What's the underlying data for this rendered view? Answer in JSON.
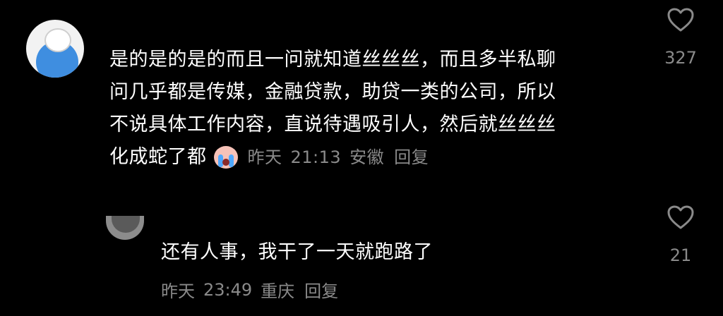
{
  "comment1": {
    "lines": [
      "是的是的是的而且一问就知道丝丝丝，而且多半私聊",
      "问几乎都是传媒，金融贷款，助贷一类的公司，所以",
      "不说具体工作内容，直说待遇吸引人，然后就丝丝丝",
      "化成蛇了都"
    ],
    "emoji": "crying-face-emoji",
    "meta": {
      "date": "昨天",
      "time": "21:13",
      "location": "安徽",
      "reply": "回复"
    },
    "likes": "327"
  },
  "comment2": {
    "text": "还有人事，我干了一天就跑路了",
    "meta": {
      "date": "昨天",
      "time": "23:49",
      "location": "重庆",
      "reply": "回复"
    },
    "likes": "21"
  },
  "colors": {
    "background": "#000000",
    "text": "#ffffff",
    "meta": "#8a8a8a"
  }
}
